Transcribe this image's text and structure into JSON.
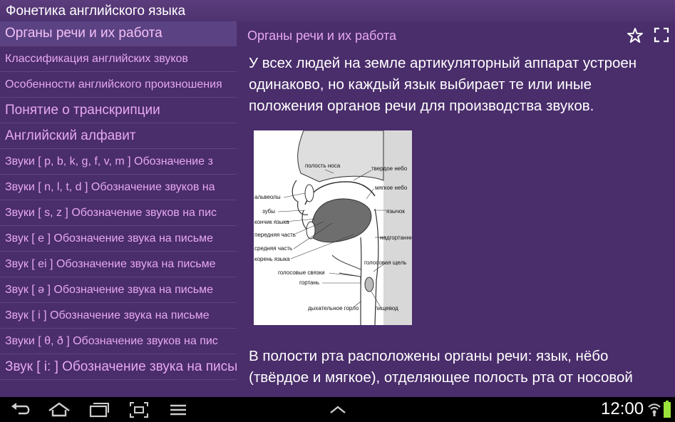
{
  "app": {
    "title": "Фонетика английского языка"
  },
  "sidebar": {
    "items": [
      {
        "label": "Органы речи и их работа"
      },
      {
        "label": "Классификация английских звуков"
      },
      {
        "label": "Особенности английского произношения"
      },
      {
        "label": "Понятие о транскрипции"
      },
      {
        "label": "Английский алфавит"
      },
      {
        "label": "Звуки [ p, b, k, g, f, v, m ] Обозначение з"
      },
      {
        "label": "Звуки [ n, l, t, d ] Обозначение звуков на"
      },
      {
        "label": "Звуки [ s, z ] Обозначение звуков на пис"
      },
      {
        "label": "Звук [ e ] Обозначение звука на письме"
      },
      {
        "label": "Звук [ ei ] Обозначение звука на письме"
      },
      {
        "label": "Звук [ ə ] Обозначение звука на письме"
      },
      {
        "label": "Звук [ i ] Обозначение звука на письме"
      },
      {
        "label": "Звуки [ θ, ð ] Обозначение звуков на пис"
      },
      {
        "label": "Звук [ i: ] Обозначение звука на письм"
      }
    ]
  },
  "content": {
    "title": "Органы речи и их работа",
    "paragraph1": "У всех людей на земле артикуляторный аппарат устроен одинаково, но каждый язык выбирает те или иные положения органов речи для производства звуков.",
    "paragraph2": "В полости рта расположены органы речи: язык, нёбо (твёрдое и мягкое), отделяющее полость рта от носовой",
    "diagram_labels": {
      "nasal_cavity": "полость носа",
      "hard_palate": "твердое небо",
      "soft_palate": "мягкое небо",
      "alveoli": "альвеолы",
      "teeth": "зубы",
      "uvula": "язычок",
      "tongue_tip": "кончик языка",
      "front_part": "передняя часть",
      "epiglottis": "надгортанник",
      "middle_part": "средняя часть",
      "tongue_root": "корень языка",
      "glottis": "голосовая щель",
      "vocal_cords": "голосовые связки",
      "larynx": "гортань",
      "trachea": "дыхательное горло",
      "esophagus": "пищевод"
    }
  },
  "statusbar": {
    "time": "12:00"
  },
  "icons": {
    "back": "back-icon",
    "home": "home-icon",
    "recents": "recent-apps-icon",
    "screenshot": "screenshot-icon",
    "menu": "menu-icon",
    "up": "chevron-up-icon",
    "wifi": "wifi-icon",
    "battery": "battery-icon",
    "star": "star-icon",
    "fullscreen": "fullscreen-icon"
  },
  "colors": {
    "background": "#4a2d6b",
    "accent": "#e6a8f0",
    "selected": "#5b4283",
    "battery": "#9be33b"
  }
}
